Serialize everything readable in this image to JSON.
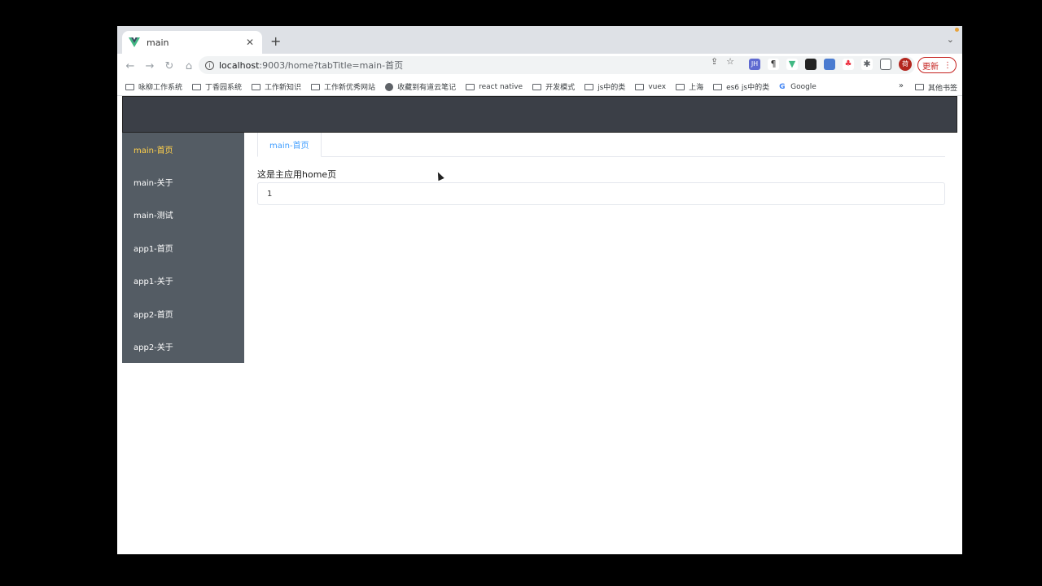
{
  "browser": {
    "tab_title": "main",
    "url_host": "localhost",
    "url_path": ":9003/home?tabTitle=main-首页",
    "update_label": "更新",
    "avatar_letter": "荷"
  },
  "bookmarks": {
    "items": [
      {
        "label": "咏柳工作系统",
        "icon": "folder-icon"
      },
      {
        "label": "丁香园系统",
        "icon": "folder-icon"
      },
      {
        "label": "工作新知识",
        "icon": "folder-icon"
      },
      {
        "label": "工作新优秀网站",
        "icon": "folder-icon"
      },
      {
        "label": "收藏到有道云笔记",
        "icon": "globe-icon"
      },
      {
        "label": "react native",
        "icon": "folder-icon"
      },
      {
        "label": "开发模式",
        "icon": "folder-icon"
      },
      {
        "label": "js中的类",
        "icon": "folder-icon"
      },
      {
        "label": "vuex",
        "icon": "folder-icon"
      },
      {
        "label": "上海",
        "icon": "folder-icon"
      },
      {
        "label": "es6 js中的类",
        "icon": "folder-icon"
      },
      {
        "label": "Google",
        "icon": "google-icon"
      }
    ],
    "more": "»",
    "other": "其他书签"
  },
  "sidebar": {
    "items": [
      {
        "label": "main-首页"
      },
      {
        "label": "main-关于"
      },
      {
        "label": "main-测试"
      },
      {
        "label": "app1-首页"
      },
      {
        "label": "app1-关于"
      },
      {
        "label": "app2-首页"
      },
      {
        "label": "app2-关于"
      }
    ]
  },
  "colors": {
    "sidebar_bg": "#545c64",
    "active_text": "#ffd04b",
    "header_bg": "#3b3f47",
    "tab_active": "#409eff"
  },
  "content": {
    "tab_label": "main-首页",
    "heading": "这是主应用home页",
    "box_value": "1"
  }
}
